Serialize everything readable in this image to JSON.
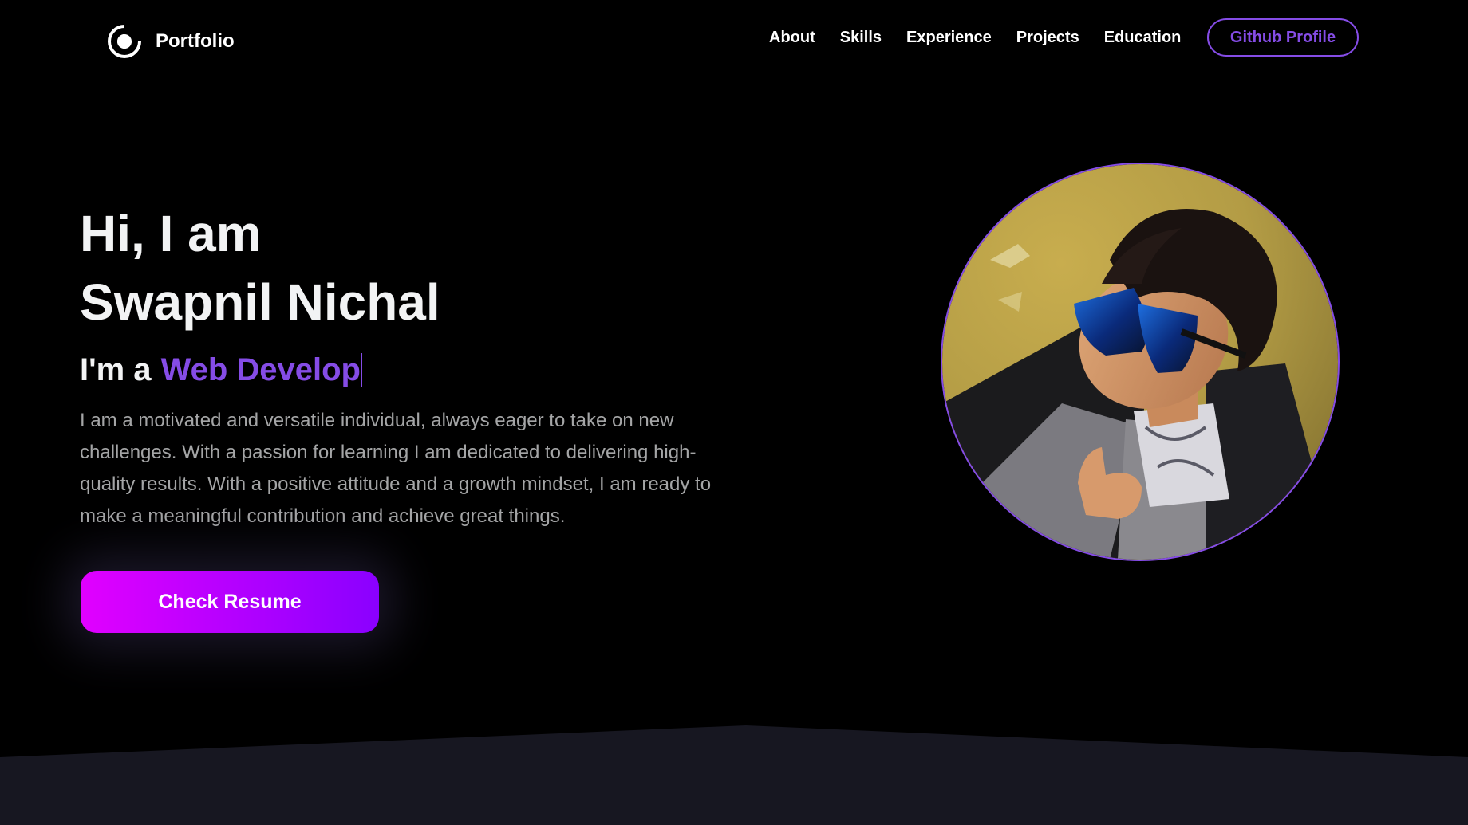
{
  "nav": {
    "brand": "Portfolio",
    "links": [
      {
        "label": "About"
      },
      {
        "label": "Skills"
      },
      {
        "label": "Experience"
      },
      {
        "label": "Projects"
      },
      {
        "label": "Education"
      }
    ],
    "github_button": "Github Profile"
  },
  "hero": {
    "greeting": "Hi, I am",
    "name": "Swapnil Nichal",
    "role_prefix": "I'm a",
    "role_typed": "Web Develop",
    "description": "I am a motivated and versatile individual, always eager to take on new challenges. With a passion for learning I am dedicated to delivering high-quality results. With a positive attitude and a growth mindset, I am ready to make a meaningful contribution and achieve great things.",
    "resume_button": "Check Resume"
  },
  "colors": {
    "background": "#000000",
    "accent": "#854ce6",
    "text": "#f2f3f4",
    "next_section_bg": "#171721",
    "button_gradient_start": "#e100ff",
    "button_gradient_end": "#8a00ff"
  },
  "icons": {
    "brand": "portfolio-logo-icon"
  }
}
